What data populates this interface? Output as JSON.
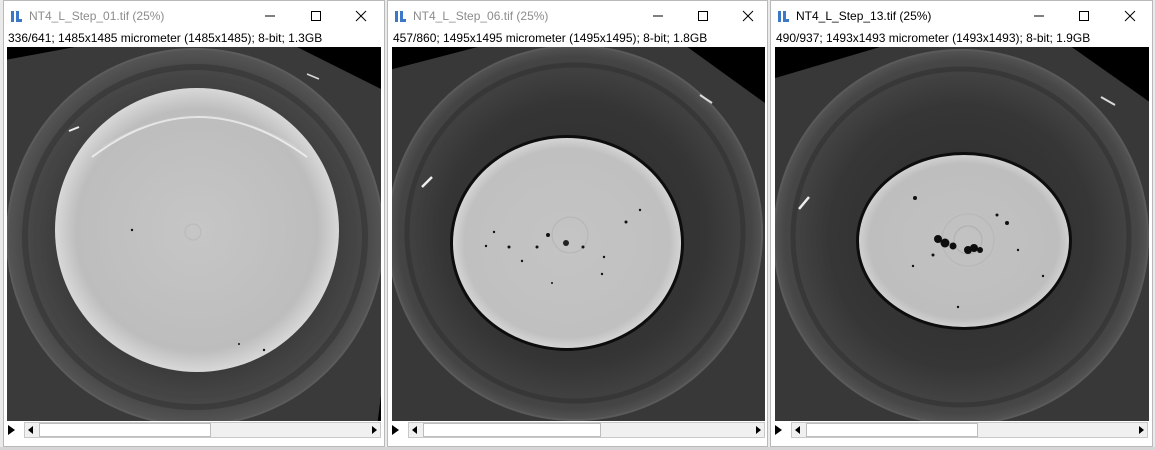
{
  "windows": [
    {
      "title": "NT4_L_Step_01.tif (25%)",
      "info": "336/641; 1485x1485 micrometer (1485x1485); 8-bit; 1.3GB",
      "slice_position": 0.52
    },
    {
      "title": "NT4_L_Step_06.tif (25%)",
      "info": "457/860; 1495x1495 micrometer (1495x1495); 8-bit; 1.8GB",
      "slice_position": 0.53
    },
    {
      "title": "NT4_L_Step_13.tif (25%)",
      "info": "490/937; 1493x1493 micrometer (1493x1493); 8-bit; 1.9GB",
      "slice_position": 0.52
    }
  ],
  "colors": {
    "title_text": "#8c8c8c",
    "icon_blue": "#3c78c8",
    "scan_background": "#000000",
    "outer_ring": "#3a3a3a",
    "inner_core": "#c8c8c8"
  },
  "icons": {
    "window_icon": "imagej-icon",
    "minimize": "minimize-icon",
    "maximize": "maximize-icon",
    "close": "close-icon",
    "animate": "play-icon"
  }
}
